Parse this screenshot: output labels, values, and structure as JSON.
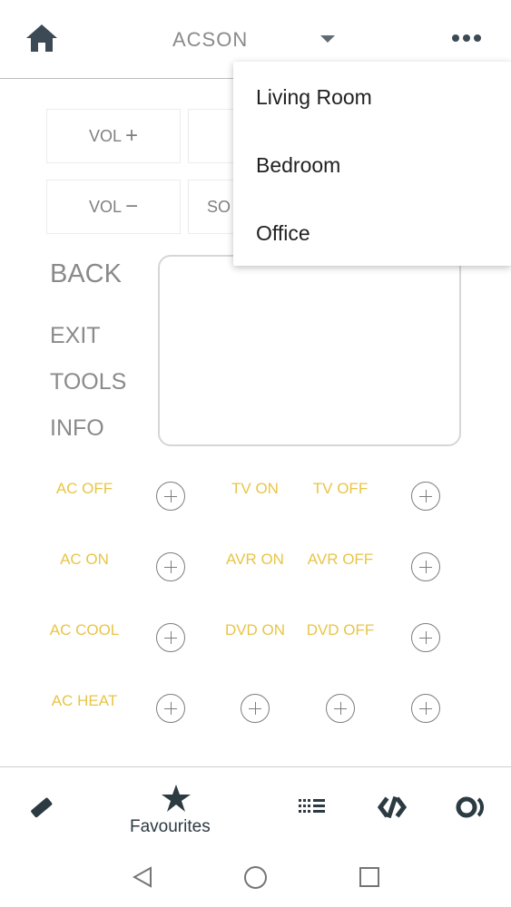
{
  "header": {
    "title": "ACSON",
    "home_icon": "home-icon",
    "more_icon": "more-icon"
  },
  "remote": {
    "vol_plus": {
      "text": "VOL",
      "sign": "+"
    },
    "vol_minus": {
      "text": "VOL",
      "sign": "−"
    },
    "partial_left": "SO",
    "back": "BACK",
    "exit": "EXIT",
    "tools": "TOOLS",
    "info": "INFO"
  },
  "favourites": [
    [
      "AC OFF",
      "TV ON",
      "TV OFF"
    ],
    [
      "AC ON",
      "AVR ON",
      "AVR OFF"
    ],
    [
      "AC COOL",
      "DVD ON",
      "DVD OFF"
    ],
    [
      "AC HEAT"
    ]
  ],
  "menu": {
    "items": [
      "Living Room",
      "Bedroom",
      "Office"
    ]
  },
  "tabs": {
    "active_label": "Favourites",
    "icons": [
      "remote-icon",
      "star-icon",
      "grid-list-icon",
      "code-icon",
      "activity-icon"
    ]
  },
  "colors": {
    "accent": "#e8c547",
    "icon_dark": "#2c3a42"
  }
}
